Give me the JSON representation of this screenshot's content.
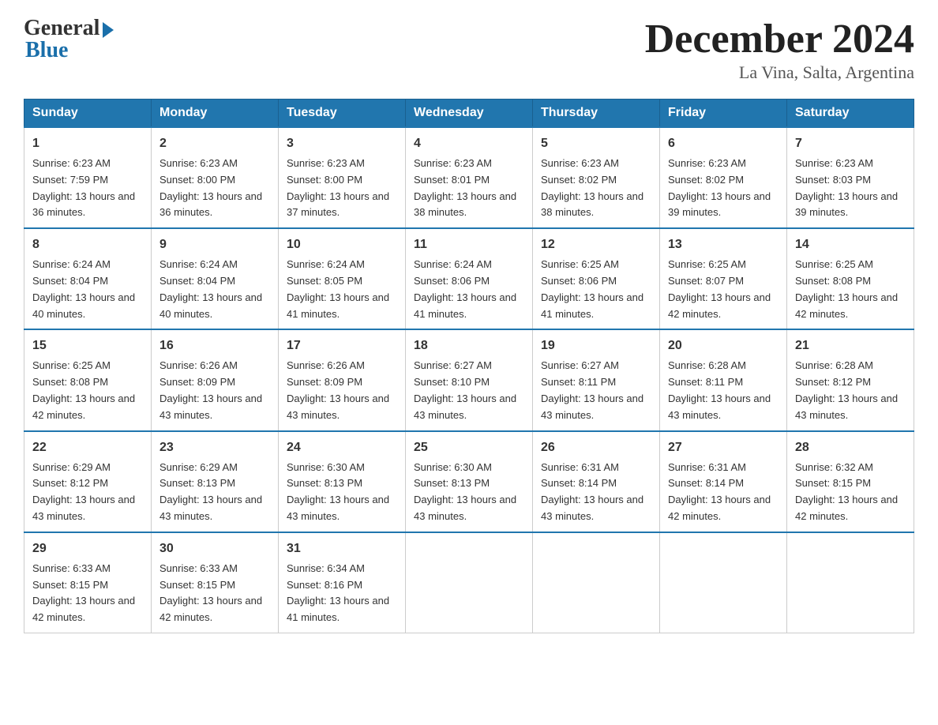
{
  "header": {
    "logo_general": "General",
    "logo_blue": "Blue",
    "month_title": "December 2024",
    "location": "La Vina, Salta, Argentina"
  },
  "days_of_week": [
    "Sunday",
    "Monday",
    "Tuesday",
    "Wednesday",
    "Thursday",
    "Friday",
    "Saturday"
  ],
  "weeks": [
    [
      {
        "day": "1",
        "sunrise": "6:23 AM",
        "sunset": "7:59 PM",
        "daylight": "13 hours and 36 minutes."
      },
      {
        "day": "2",
        "sunrise": "6:23 AM",
        "sunset": "8:00 PM",
        "daylight": "13 hours and 36 minutes."
      },
      {
        "day": "3",
        "sunrise": "6:23 AM",
        "sunset": "8:00 PM",
        "daylight": "13 hours and 37 minutes."
      },
      {
        "day": "4",
        "sunrise": "6:23 AM",
        "sunset": "8:01 PM",
        "daylight": "13 hours and 38 minutes."
      },
      {
        "day": "5",
        "sunrise": "6:23 AM",
        "sunset": "8:02 PM",
        "daylight": "13 hours and 38 minutes."
      },
      {
        "day": "6",
        "sunrise": "6:23 AM",
        "sunset": "8:02 PM",
        "daylight": "13 hours and 39 minutes."
      },
      {
        "day": "7",
        "sunrise": "6:23 AM",
        "sunset": "8:03 PM",
        "daylight": "13 hours and 39 minutes."
      }
    ],
    [
      {
        "day": "8",
        "sunrise": "6:24 AM",
        "sunset": "8:04 PM",
        "daylight": "13 hours and 40 minutes."
      },
      {
        "day": "9",
        "sunrise": "6:24 AM",
        "sunset": "8:04 PM",
        "daylight": "13 hours and 40 minutes."
      },
      {
        "day": "10",
        "sunrise": "6:24 AM",
        "sunset": "8:05 PM",
        "daylight": "13 hours and 41 minutes."
      },
      {
        "day": "11",
        "sunrise": "6:24 AM",
        "sunset": "8:06 PM",
        "daylight": "13 hours and 41 minutes."
      },
      {
        "day": "12",
        "sunrise": "6:25 AM",
        "sunset": "8:06 PM",
        "daylight": "13 hours and 41 minutes."
      },
      {
        "day": "13",
        "sunrise": "6:25 AM",
        "sunset": "8:07 PM",
        "daylight": "13 hours and 42 minutes."
      },
      {
        "day": "14",
        "sunrise": "6:25 AM",
        "sunset": "8:08 PM",
        "daylight": "13 hours and 42 minutes."
      }
    ],
    [
      {
        "day": "15",
        "sunrise": "6:25 AM",
        "sunset": "8:08 PM",
        "daylight": "13 hours and 42 minutes."
      },
      {
        "day": "16",
        "sunrise": "6:26 AM",
        "sunset": "8:09 PM",
        "daylight": "13 hours and 43 minutes."
      },
      {
        "day": "17",
        "sunrise": "6:26 AM",
        "sunset": "8:09 PM",
        "daylight": "13 hours and 43 minutes."
      },
      {
        "day": "18",
        "sunrise": "6:27 AM",
        "sunset": "8:10 PM",
        "daylight": "13 hours and 43 minutes."
      },
      {
        "day": "19",
        "sunrise": "6:27 AM",
        "sunset": "8:11 PM",
        "daylight": "13 hours and 43 minutes."
      },
      {
        "day": "20",
        "sunrise": "6:28 AM",
        "sunset": "8:11 PM",
        "daylight": "13 hours and 43 minutes."
      },
      {
        "day": "21",
        "sunrise": "6:28 AM",
        "sunset": "8:12 PM",
        "daylight": "13 hours and 43 minutes."
      }
    ],
    [
      {
        "day": "22",
        "sunrise": "6:29 AM",
        "sunset": "8:12 PM",
        "daylight": "13 hours and 43 minutes."
      },
      {
        "day": "23",
        "sunrise": "6:29 AM",
        "sunset": "8:13 PM",
        "daylight": "13 hours and 43 minutes."
      },
      {
        "day": "24",
        "sunrise": "6:30 AM",
        "sunset": "8:13 PM",
        "daylight": "13 hours and 43 minutes."
      },
      {
        "day": "25",
        "sunrise": "6:30 AM",
        "sunset": "8:13 PM",
        "daylight": "13 hours and 43 minutes."
      },
      {
        "day": "26",
        "sunrise": "6:31 AM",
        "sunset": "8:14 PM",
        "daylight": "13 hours and 43 minutes."
      },
      {
        "day": "27",
        "sunrise": "6:31 AM",
        "sunset": "8:14 PM",
        "daylight": "13 hours and 42 minutes."
      },
      {
        "day": "28",
        "sunrise": "6:32 AM",
        "sunset": "8:15 PM",
        "daylight": "13 hours and 42 minutes."
      }
    ],
    [
      {
        "day": "29",
        "sunrise": "6:33 AM",
        "sunset": "8:15 PM",
        "daylight": "13 hours and 42 minutes."
      },
      {
        "day": "30",
        "sunrise": "6:33 AM",
        "sunset": "8:15 PM",
        "daylight": "13 hours and 42 minutes."
      },
      {
        "day": "31",
        "sunrise": "6:34 AM",
        "sunset": "8:16 PM",
        "daylight": "13 hours and 41 minutes."
      },
      null,
      null,
      null,
      null
    ]
  ]
}
